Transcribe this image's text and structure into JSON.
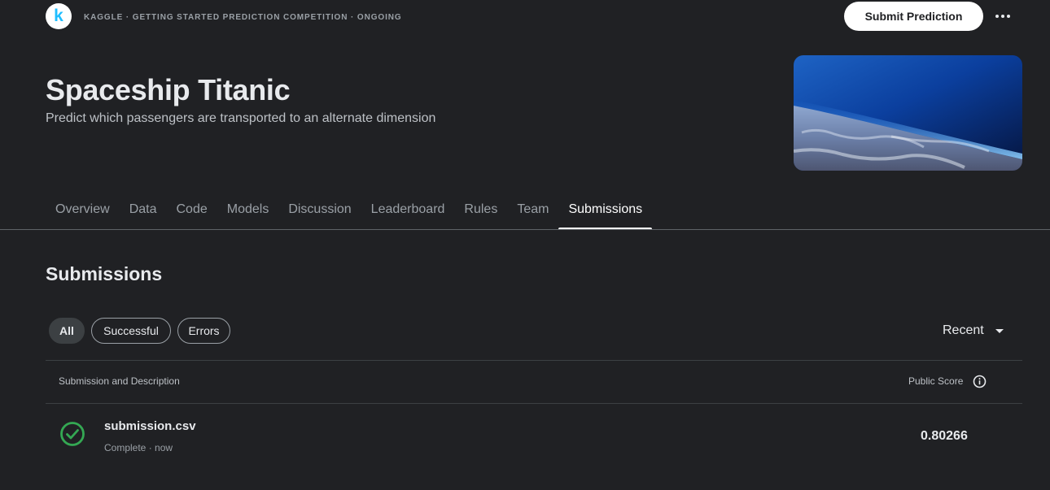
{
  "header": {
    "logo_letter": "k",
    "breadcrumb": "KAGGLE · GETTING STARTED PREDICTION COMPETITION · ONGOING",
    "submit_label": "Submit Prediction",
    "more_icon": "more-horiz-icon"
  },
  "hero": {
    "title": "Spaceship Titanic",
    "subtitle": "Predict which passengers are transported to an alternate dimension"
  },
  "tabs": [
    {
      "label": "Overview",
      "active": false
    },
    {
      "label": "Data",
      "active": false
    },
    {
      "label": "Code",
      "active": false
    },
    {
      "label": "Models",
      "active": false
    },
    {
      "label": "Discussion",
      "active": false
    },
    {
      "label": "Leaderboard",
      "active": false
    },
    {
      "label": "Rules",
      "active": false
    },
    {
      "label": "Team",
      "active": false
    },
    {
      "label": "Submissions",
      "active": true
    }
  ],
  "submissions": {
    "title": "Submissions",
    "filters": [
      {
        "label": "All",
        "active": true
      },
      {
        "label": "Successful",
        "active": false
      },
      {
        "label": "Errors",
        "active": false
      }
    ],
    "sort_label": "Recent",
    "columns": {
      "description": "Submission and Description",
      "score": "Public Score"
    },
    "rows": [
      {
        "file": "submission.csv",
        "status": "Complete · now",
        "score": "0.80266",
        "status_icon": "check-circle-icon"
      }
    ]
  },
  "colors": {
    "background": "#202124",
    "success": "#34a853",
    "brand": "#20beff"
  }
}
